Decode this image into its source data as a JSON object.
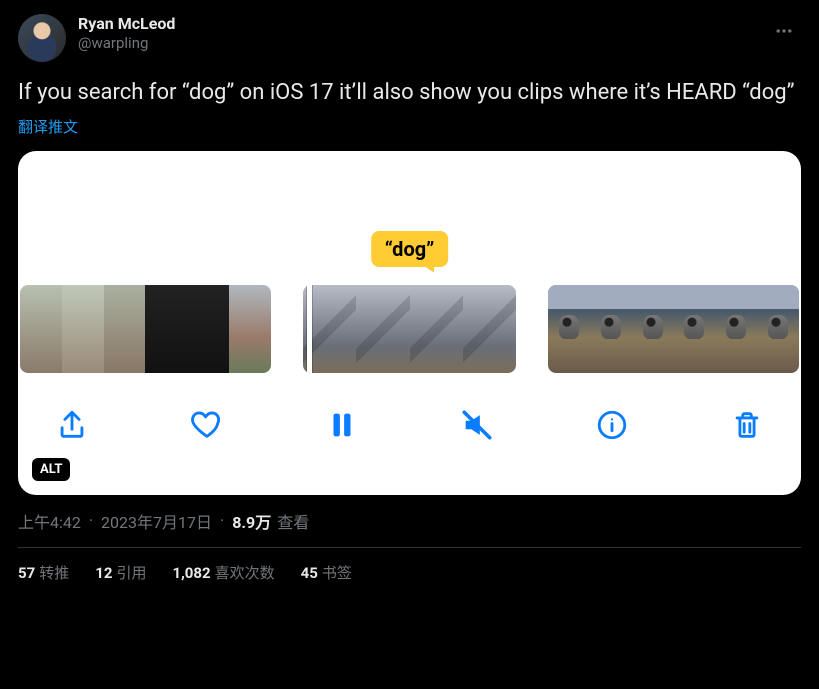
{
  "author": {
    "display_name": "Ryan McLeod",
    "handle": "@warpling"
  },
  "tweet": {
    "text": "If you search for “dog” on iOS 17 it’ll also show you clips where it’s HEARD “dog”",
    "translate_label": "翻译推文"
  },
  "media": {
    "bubble_text": "“dog”",
    "alt_badge": "ALT",
    "toolbar": {
      "share": "share",
      "like": "like",
      "pause": "pause",
      "mute": "mute",
      "info": "info",
      "trash": "trash"
    }
  },
  "meta": {
    "time": "上午4:42",
    "date": "2023年7月17日",
    "views_count": "8.9万",
    "views_label": "查看"
  },
  "stats": {
    "retweets": {
      "count": "57",
      "label": "转推"
    },
    "quotes": {
      "count": "12",
      "label": "引用"
    },
    "likes": {
      "count": "1,082",
      "label": "喜欢次数"
    },
    "bookmarks": {
      "count": "45",
      "label": "书签"
    }
  }
}
